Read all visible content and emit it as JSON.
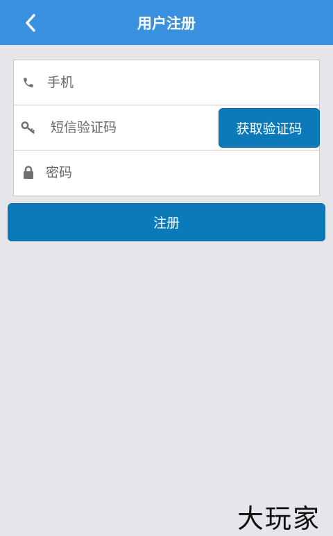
{
  "header": {
    "title": "用户注册",
    "back_icon": "chevron-left-icon",
    "background": "#3a91e0"
  },
  "form": {
    "phone": {
      "placeholder": "手机",
      "value": "",
      "icon": "phone-icon"
    },
    "sms_code": {
      "placeholder": "短信验证码",
      "value": "",
      "icon": "key-icon"
    },
    "get_code_label": "获取验证码",
    "password": {
      "placeholder": "密码",
      "value": "",
      "icon": "lock-icon"
    }
  },
  "register_label": "注册",
  "watermark": "大玩家",
  "colors": {
    "accent": "#0c7ab9",
    "background": "#e6e5e9"
  }
}
